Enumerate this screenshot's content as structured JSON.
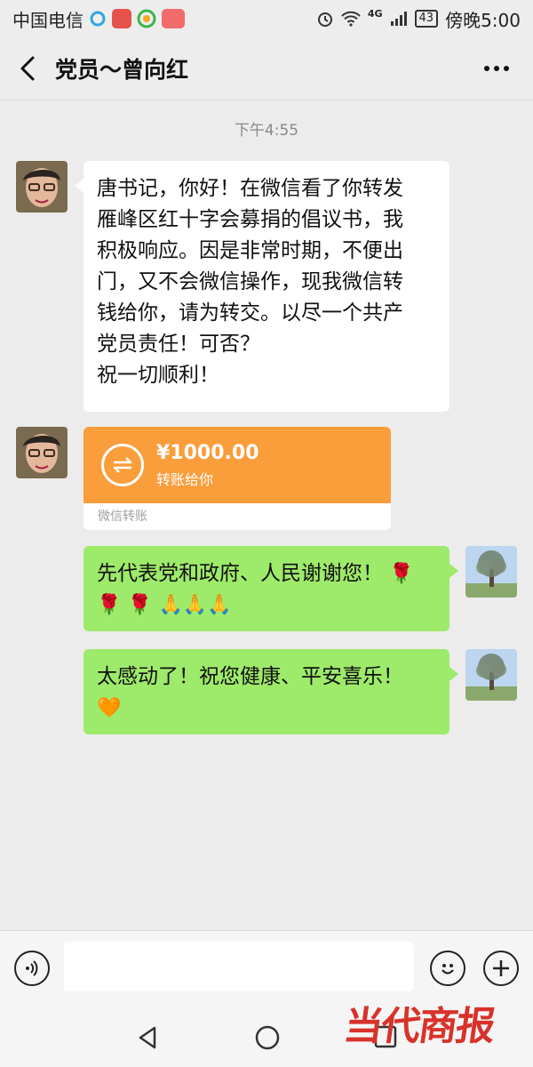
{
  "status_bar": {
    "carrier": "中国电信",
    "network": "4G",
    "battery": "43",
    "time": "傍晚5:00",
    "icons": [
      "qq-icon",
      "weibo-icon",
      "browser-icon",
      "huawei-app-icon",
      "alarm-icon",
      "wifi-icon",
      "signal-icon",
      "battery-icon"
    ]
  },
  "header": {
    "title": "党员～曾向红",
    "back_icon": "back-arrow-icon",
    "more_icon": "more-dots-icon"
  },
  "chat": {
    "timestamp": "下午4:55",
    "messages": [
      {
        "side": "left",
        "type": "text",
        "lines": [
          "唐书记，你好！在微信看了你转发",
          "雁峰区红十字会募捐的倡议书，我",
          "积极响应。因是非常时期，不便出",
          "门，又不会微信操作，现我微信转",
          "钱给你，请为转交。以尽一个共产",
          "党员责任！可否？",
          "祝一切顺利！"
        ]
      },
      {
        "side": "left",
        "type": "transfer",
        "amount": "¥1000.00",
        "label": "转账给你",
        "footer": "微信转账",
        "color": "#fa9d3b"
      },
      {
        "side": "right",
        "type": "text",
        "line1": "先代表党和政府、人民谢谢您！",
        "emoji": [
          "rose-emoji",
          "rose-emoji",
          "rose-emoji",
          "pray-emoji",
          "pray-emoji",
          "pray-emoji"
        ]
      },
      {
        "side": "right",
        "type": "text",
        "line1": "太感动了！祝您健康、平安喜乐！",
        "emoji": [
          "orange-heart-emoji"
        ]
      }
    ]
  },
  "input_bar": {
    "voice_icon": "voice-icon",
    "emoji_icon": "smiley-icon",
    "plus_icon": "plus-icon"
  },
  "nav_bar": {
    "icons": [
      "nav-back-icon",
      "nav-home-icon",
      "nav-recents-icon"
    ]
  },
  "watermark": "当代商报",
  "colors": {
    "green_bubble": "#9eea6a",
    "transfer": "#fa9d3b",
    "background": "#ececec"
  }
}
